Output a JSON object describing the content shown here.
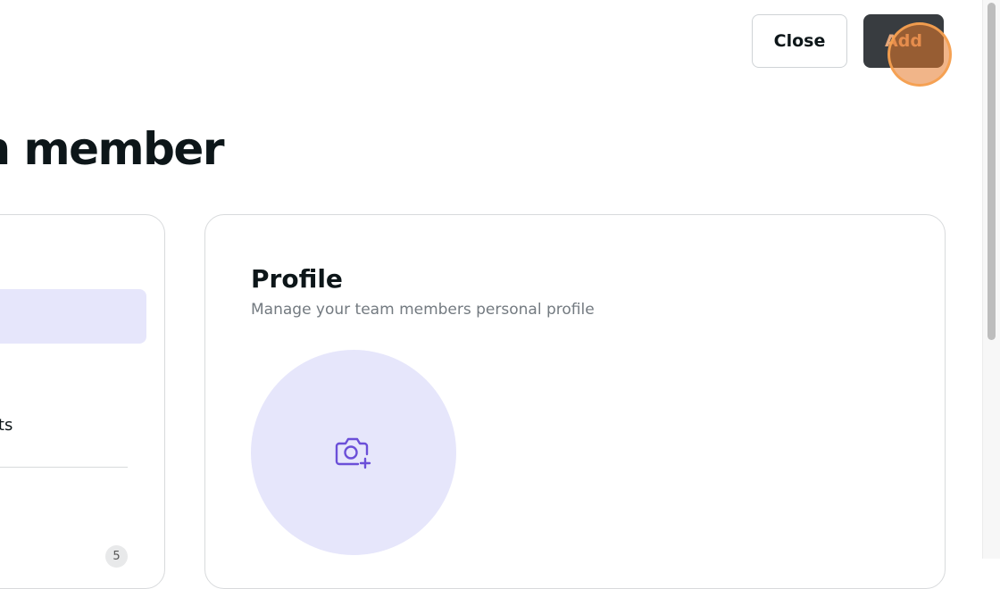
{
  "header": {
    "close_label": "Close",
    "add_label": "Add"
  },
  "page": {
    "title": "m member"
  },
  "sidebar": {
    "partial_label": "cts",
    "badge_count": "5"
  },
  "profile": {
    "heading": "Profile",
    "subtitle": "Manage your team members personal profile",
    "avatar_icon": "camera-plus-icon"
  },
  "colors": {
    "primary_dark": "#383c40",
    "accent_lavender": "#e6e6fb",
    "icon_purple": "#6b4fd8"
  }
}
